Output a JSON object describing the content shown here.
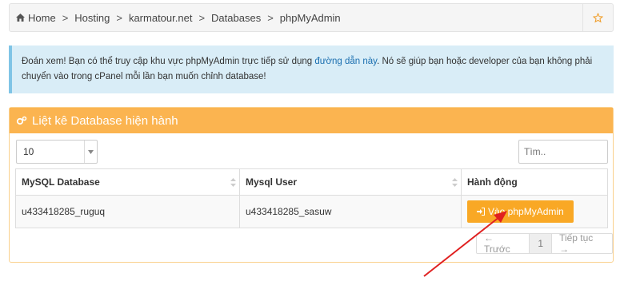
{
  "breadcrumb": {
    "items": [
      "Home",
      "Hosting",
      "karmatour.net",
      "Databases",
      "phpMyAdmin"
    ],
    "separator": ">"
  },
  "alert": {
    "text_before": "Đoán xem! Bạn có thể truy cập khu vực phpMyAdmin trực tiếp sử dụng ",
    "link": "đường dẫn này",
    "text_after": ". Nó sẽ giúp bạn hoặc developer của bạn không phải chuyển vào trong cPanel mỗi lần bạn muốn chỉnh database!"
  },
  "panel": {
    "title": "Liệt kê Database hiện hành",
    "length_value": "10",
    "search_placeholder": "Tìm..",
    "columns": [
      "MySQL Database",
      "Mysql User",
      "Hành động"
    ],
    "rows": [
      {
        "database": "u433418285_ruguq",
        "user": "u433418285_sasuw",
        "action": "Vào phpMyAdmin"
      }
    ],
    "pager": {
      "prev": "← Trước",
      "page": "1",
      "next": "Tiếp tục →"
    }
  },
  "colors": {
    "panel_header": "#fbb450",
    "button": "#f9a825",
    "alert_bg": "#d9edf7",
    "annotation_arrow": "#e02020"
  }
}
